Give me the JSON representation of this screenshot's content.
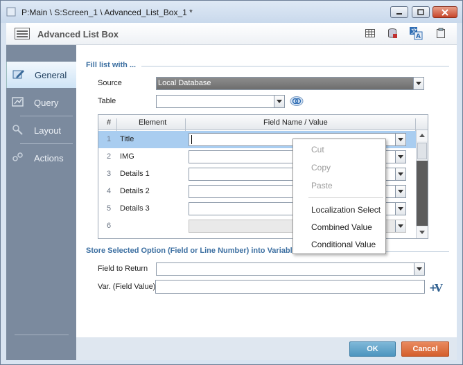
{
  "window": {
    "title": "P:Main \\ S:Screen_1 \\ Advanced_List_Box_1 *",
    "min_icon": "minimize-icon",
    "max_icon": "maximize-icon",
    "close_icon": "close-icon"
  },
  "header": {
    "title": "Advanced List Box",
    "tools": [
      "table-icon",
      "database-icon",
      "translate-icon",
      "clipboard-icon"
    ]
  },
  "sidebar": {
    "items": [
      {
        "label": "General",
        "icon": "general-edit-icon",
        "active": true
      },
      {
        "label": "Query",
        "icon": "query-icon",
        "active": false
      },
      {
        "label": "Layout",
        "icon": "layout-icon",
        "active": false
      },
      {
        "label": "Actions",
        "icon": "actions-icon",
        "active": false
      }
    ]
  },
  "fill_section": {
    "title": "Fill list with ...",
    "source_label": "Source",
    "source_value": "Local Database",
    "table_label": "Table",
    "table_value": ""
  },
  "grid": {
    "headers": [
      "#",
      "Element",
      "Field Name / Value"
    ],
    "rows": [
      {
        "num": "1",
        "element": "Title",
        "value": "",
        "selected": true
      },
      {
        "num": "2",
        "element": "IMG",
        "value": ""
      },
      {
        "num": "3",
        "element": "Details 1",
        "value": ""
      },
      {
        "num": "4",
        "element": "Details 2",
        "value": ""
      },
      {
        "num": "5",
        "element": "Details 3",
        "value": ""
      },
      {
        "num": "6",
        "element": "",
        "value": ""
      }
    ]
  },
  "store_section": {
    "title": "Store Selected Option (Field or Line Number) into Variable",
    "field_label": "Field to Return",
    "var_label": "Var. (Field Value)",
    "var_value": ""
  },
  "context_menu": {
    "items": [
      {
        "label": "Cut",
        "enabled": false
      },
      {
        "label": "Copy",
        "enabled": false
      },
      {
        "label": "Paste",
        "enabled": false
      },
      {
        "label": "Localization Select",
        "enabled": true
      },
      {
        "label": "Combined Value",
        "enabled": true
      },
      {
        "label": "Conditional Value",
        "enabled": true
      }
    ]
  },
  "footer": {
    "ok_label": "OK",
    "cancel_label": "Cancel"
  },
  "colors": {
    "accent": "#3c6fa1",
    "ok_button": "#4d95bf",
    "cancel_button": "#d55f2c",
    "sidebar": "#7b8a9e",
    "selection": "#a9cdf0"
  }
}
